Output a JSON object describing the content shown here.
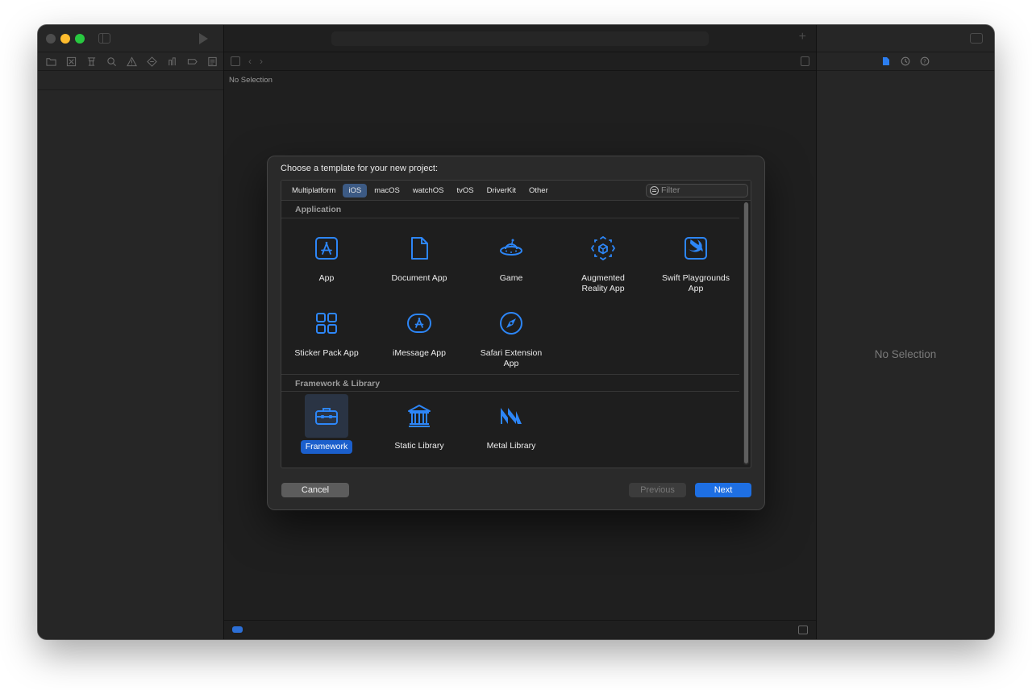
{
  "editor": {
    "jump_no_selection": "No Selection"
  },
  "inspector": {
    "no_selection": "No Selection"
  },
  "dialog": {
    "title": "Choose a template for your new project:",
    "platforms": [
      "Multiplatform",
      "iOS",
      "macOS",
      "watchOS",
      "tvOS",
      "DriverKit",
      "Other"
    ],
    "active_platform": "iOS",
    "filter_placeholder": "Filter",
    "sections": [
      {
        "header": "Application",
        "items": [
          "App",
          "Document App",
          "Game",
          "Augmented\nReality App",
          "Swift Playgrounds\nApp",
          "Sticker Pack App",
          "iMessage App",
          "Safari Extension\nApp"
        ]
      },
      {
        "header": "Framework & Library",
        "items": [
          "Framework",
          "Static Library",
          "Metal Library"
        ]
      }
    ],
    "selected_item": "Framework",
    "buttons": {
      "cancel": "Cancel",
      "previous": "Previous",
      "next": "Next"
    }
  },
  "colors": {
    "accent": "#1e6fe3",
    "icon_blue": "#2d86f7",
    "window_bg": "#1e1e1e"
  }
}
